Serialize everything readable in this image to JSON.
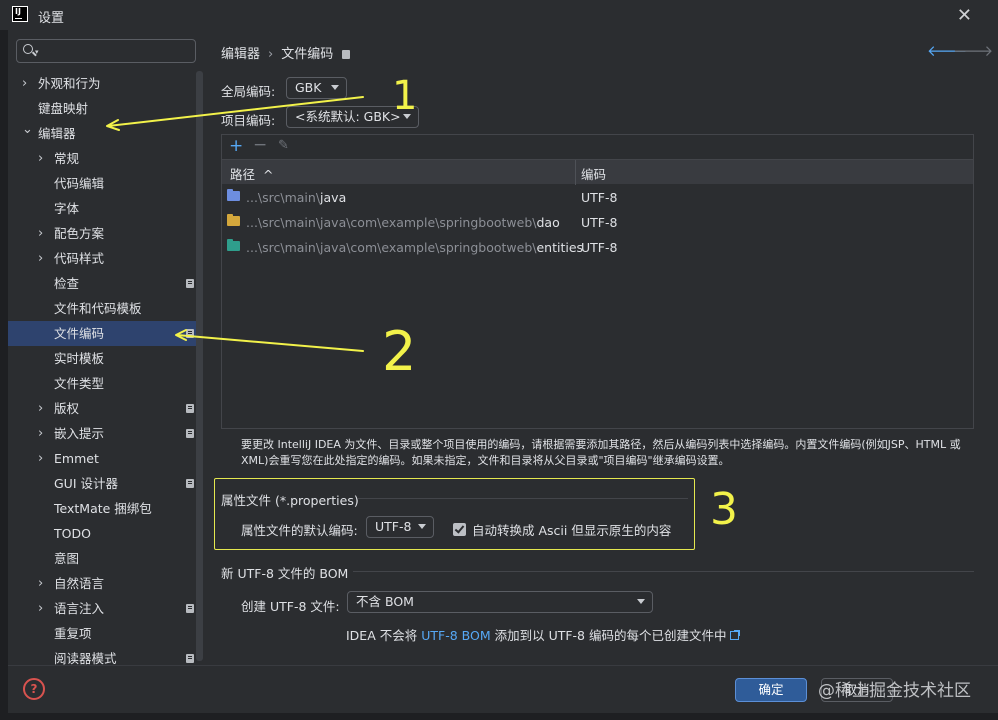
{
  "window": {
    "title": "设置",
    "logo_text": "IJ"
  },
  "search": {
    "placeholder": ""
  },
  "sidebar": {
    "items": [
      {
        "label": "外观和行为",
        "has_arrow": true,
        "expanded": false,
        "badge": false
      },
      {
        "label": "键盘映射",
        "has_arrow": false,
        "badge": false
      },
      {
        "label": "编辑器",
        "has_arrow": true,
        "expanded": true,
        "badge": false
      },
      {
        "label": "常规",
        "has_arrow": true,
        "expanded": false,
        "badge": false
      },
      {
        "label": "代码编辑",
        "has_arrow": false,
        "badge": false
      },
      {
        "label": "字体",
        "has_arrow": false,
        "badge": false
      },
      {
        "label": "配色方案",
        "has_arrow": true,
        "expanded": false,
        "badge": false
      },
      {
        "label": "代码样式",
        "has_arrow": true,
        "expanded": false,
        "badge": false
      },
      {
        "label": "检查",
        "has_arrow": false,
        "badge": true
      },
      {
        "label": "文件和代码模板",
        "has_arrow": false,
        "badge": false
      },
      {
        "label": "文件编码",
        "has_arrow": false,
        "badge": true,
        "selected": true
      },
      {
        "label": "实时模板",
        "has_arrow": false,
        "badge": false
      },
      {
        "label": "文件类型",
        "has_arrow": false,
        "badge": false
      },
      {
        "label": "版权",
        "has_arrow": true,
        "expanded": false,
        "badge": true
      },
      {
        "label": "嵌入提示",
        "has_arrow": true,
        "expanded": false,
        "badge": true
      },
      {
        "label": "Emmet",
        "has_arrow": true,
        "expanded": false,
        "badge": false
      },
      {
        "label": "GUI 设计器",
        "has_arrow": false,
        "badge": true
      },
      {
        "label": "TextMate 捆绑包",
        "has_arrow": false,
        "badge": false
      },
      {
        "label": "TODO",
        "has_arrow": false,
        "badge": false
      },
      {
        "label": "意图",
        "has_arrow": false,
        "badge": false
      },
      {
        "label": "自然语言",
        "has_arrow": true,
        "expanded": false,
        "badge": false
      },
      {
        "label": "语言注入",
        "has_arrow": true,
        "expanded": false,
        "badge": true
      },
      {
        "label": "重复项",
        "has_arrow": false,
        "badge": false
      },
      {
        "label": "阅读器模式",
        "has_arrow": false,
        "badge": true
      }
    ]
  },
  "breadcrumb": {
    "parent": "编辑器",
    "separator": "›",
    "current": "文件编码"
  },
  "global_encoding": {
    "label": "全局编码:",
    "value": "GBK"
  },
  "project_encoding": {
    "label": "项目编码:",
    "value": "<系统默认: GBK>"
  },
  "table": {
    "columns": {
      "path": "路径",
      "sort_arrow": "^",
      "encoding": "编码"
    },
    "rows": [
      {
        "path_prefix": "...\\src\\main\\",
        "path_name": "java",
        "encoding": "UTF-8",
        "icon": "blue-folder-icon",
        "icon_color": "#6d8ee0"
      },
      {
        "path_prefix": "...\\src\\main\\java\\com\\example\\springbootweb\\",
        "path_name": "dao",
        "encoding": "UTF-8",
        "icon": "yellow-folder-icon",
        "icon_color": "#d4a73c"
      },
      {
        "path_prefix": "...\\src\\main\\java\\com\\example\\springbootweb\\",
        "path_name": "entities",
        "encoding": "UTF-8",
        "icon": "teal-folder-icon",
        "icon_color": "#2f9e8c"
      }
    ]
  },
  "description": {
    "line1": "要更改 IntelliJ IDEA 为文件、目录或整个项目使用的编码，请根据需要添加其路径，然后从编码列表中选择编码。内置文件编码(例如JSP、HTML 或",
    "line2": "XML)会重写您在此处指定的编码。如果未指定，文件和目录将从父目录或\"项目编码\"继承编码设置。"
  },
  "properties": {
    "section_title": "属性文件 (*.properties)",
    "default_label": "属性文件的默认编码:",
    "default_value": "UTF-8",
    "checkbox_checked": true,
    "checkbox_label": "自动转换成 Ascii 但显示原生的内容"
  },
  "bom": {
    "section_title": "新 UTF-8 文件的 BOM",
    "create_label": "创建 UTF-8 文件:",
    "create_value": "不含 BOM",
    "note_prefix": "IDEA 不会将 ",
    "note_link": "UTF-8 BOM",
    "note_suffix": " 添加到以 UTF-8 编码的每个已创建文件中"
  },
  "footer": {
    "help": "?",
    "ok": "确定",
    "cancel": "取消"
  },
  "watermark": "@稀土掘金技术社区",
  "annotations": {
    "one": "1",
    "two": "2",
    "three": "3",
    "color": "#f2f24a"
  }
}
